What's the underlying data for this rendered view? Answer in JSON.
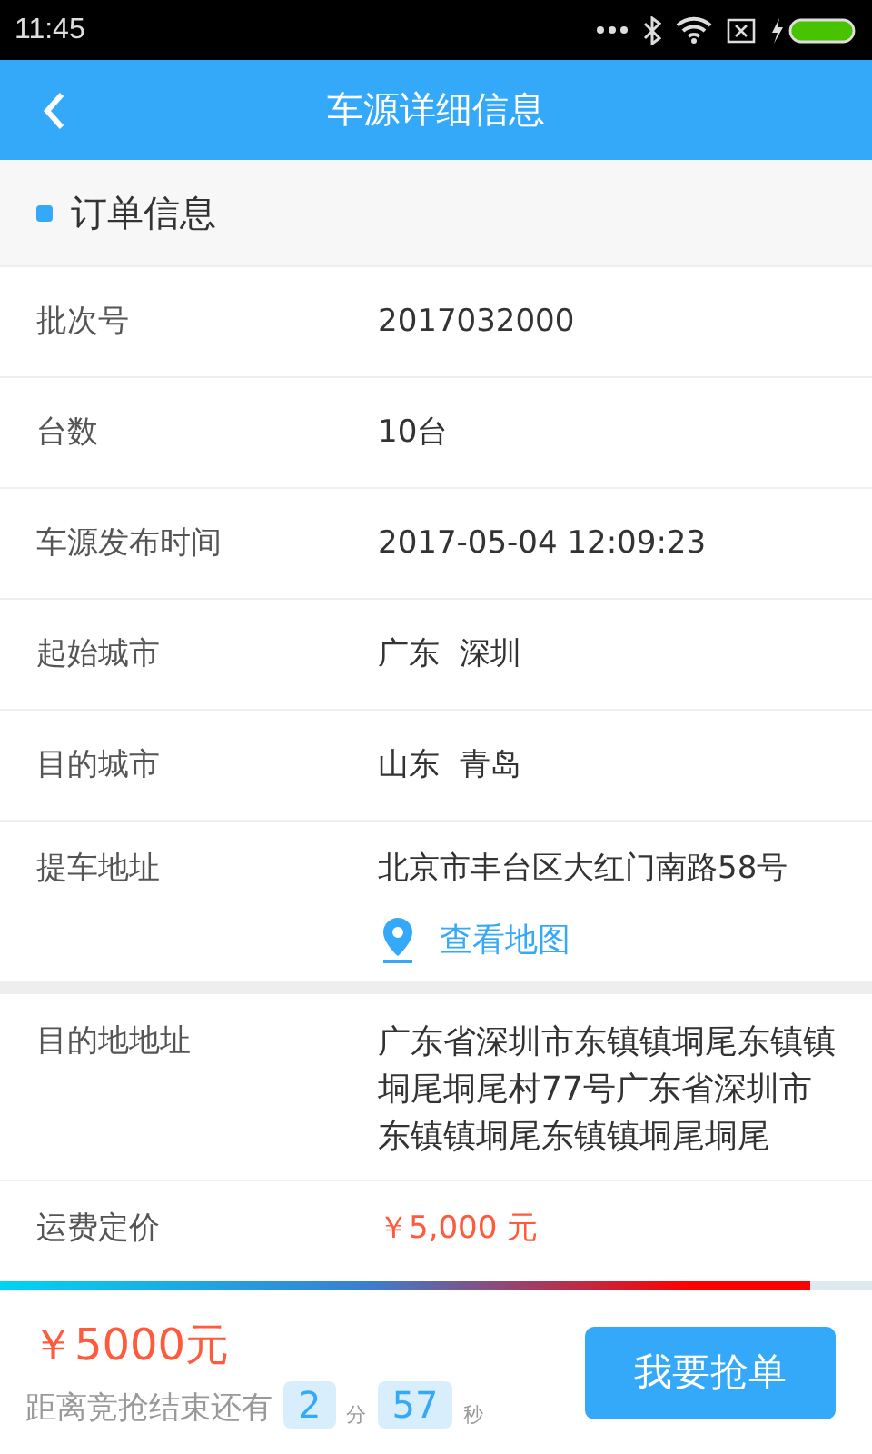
{
  "status_bar": {
    "time": "11:45"
  },
  "header": {
    "title": "车源详细信息"
  },
  "section": {
    "title": "订单信息"
  },
  "groups": [
    [
      {
        "kind": "text",
        "label": "批次号",
        "value": "2017032000"
      },
      {
        "kind": "text",
        "label": "台数",
        "value": "10台"
      },
      {
        "kind": "text",
        "label": "车源发布时间",
        "value": "2017-05-04 12:09:23"
      },
      {
        "kind": "text",
        "label": "起始城市",
        "value": "广东  深圳"
      },
      {
        "kind": "text",
        "label": "目的城市",
        "value": "山东  青岛"
      },
      {
        "kind": "address",
        "label": "提车地址",
        "value": "北京市丰台区大红门南路58号",
        "link": "查看地图"
      }
    ],
    [
      {
        "kind": "long",
        "label": "目的地地址",
        "value": "广东省深圳市东镇镇垌尾东镇镇垌尾垌尾村77号广东省深圳市东镇镇垌尾东镇镇垌尾垌尾"
      },
      {
        "kind": "price",
        "label": "运费定价",
        "value": "￥5,000 元"
      }
    ]
  ],
  "footer": {
    "progress": {
      "level": 0.93
    },
    "price": "￥5000元",
    "countdown_label": "距离竞抢结束还有",
    "minutes": "2",
    "minutes_unit": "分",
    "seconds": "57",
    "seconds_unit": "秒",
    "button": "我要抢单"
  }
}
